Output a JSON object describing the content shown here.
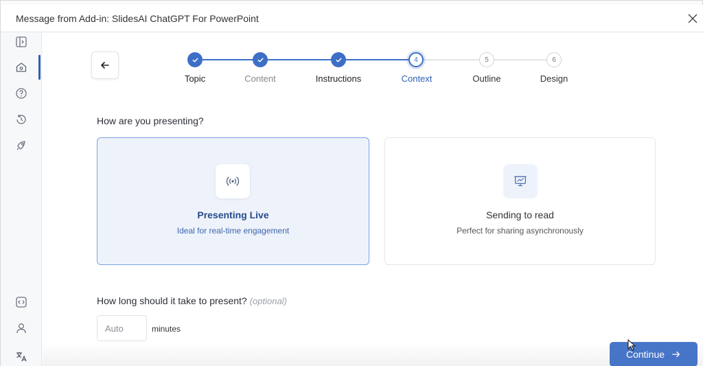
{
  "window": {
    "title": "Message from Add-in: SlidesAI ChatGPT For PowerPoint",
    "close_icon": "close-icon"
  },
  "sidebar": {
    "items": [
      {
        "name": "sidebar-toggle",
        "icon": "panel-icon"
      },
      {
        "name": "home",
        "icon": "home-icon",
        "active": true
      },
      {
        "name": "help",
        "icon": "help-icon"
      },
      {
        "name": "history",
        "icon": "history-icon"
      },
      {
        "name": "launch",
        "icon": "rocket-icon"
      },
      {
        "name": "embed",
        "icon": "code-icon"
      },
      {
        "name": "account",
        "icon": "user-icon"
      },
      {
        "name": "language",
        "icon": "translate-icon"
      }
    ]
  },
  "stepper": {
    "steps": [
      {
        "number": "1",
        "label": "Topic",
        "state": "done"
      },
      {
        "number": "2",
        "label": "Content",
        "state": "done"
      },
      {
        "number": "3",
        "label": "Instructions",
        "state": "done"
      },
      {
        "number": "4",
        "label": "Context",
        "state": "current"
      },
      {
        "number": "5",
        "label": "Outline",
        "state": "pending"
      },
      {
        "number": "6",
        "label": "Design",
        "state": "pending"
      }
    ]
  },
  "presentation_mode": {
    "question": "How are you presenting?",
    "options": [
      {
        "title": "Presenting Live",
        "subtitle": "Ideal for real-time engagement",
        "icon": "broadcast-icon",
        "selected": true
      },
      {
        "title": "Sending to read",
        "subtitle": "Perfect for sharing asynchronously",
        "icon": "presentation-board-icon",
        "selected": false
      }
    ]
  },
  "duration": {
    "question": "How long should it take to present?",
    "optional_label": "(optional)",
    "placeholder": "Auto",
    "value": "",
    "unit_label": "minutes"
  },
  "actions": {
    "continue_label": "Continue"
  },
  "colors": {
    "accent": "#2f63c1",
    "step_done": "#3d6fc6",
    "selected_card_bg": "#eef3fb",
    "selected_card_border": "#7ba2e0"
  }
}
